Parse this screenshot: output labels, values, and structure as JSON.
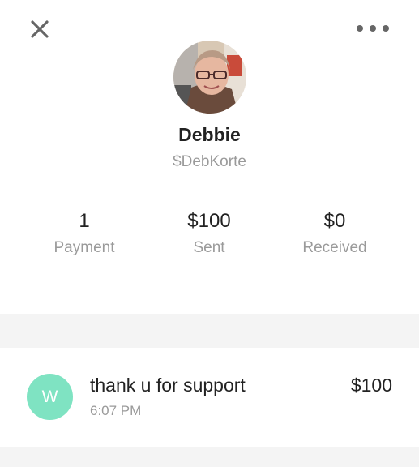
{
  "header": {
    "close_icon": "close-icon",
    "more_icon": "more-horizontal-icon"
  },
  "profile": {
    "name": "Debbie",
    "handle": "$DebKorte"
  },
  "stats": [
    {
      "value": "1",
      "label": "Payment"
    },
    {
      "value": "$100",
      "label": "Sent"
    },
    {
      "value": "$0",
      "label": "Received"
    }
  ],
  "activity": [
    {
      "initial": "W",
      "title": "thank u for support",
      "time": "6:07 PM",
      "amount": "$100",
      "avatar_color": "#7fe3c2"
    }
  ],
  "colors": {
    "text_primary": "#222222",
    "text_secondary": "#9a9a9a",
    "band": "#f4f4f4"
  }
}
